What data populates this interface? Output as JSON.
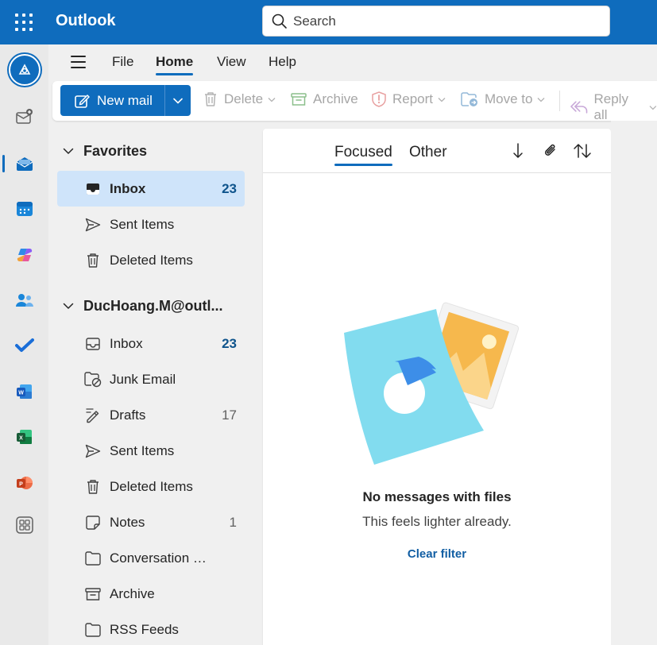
{
  "app": {
    "title": "Outlook"
  },
  "search": {
    "placeholder": "Search"
  },
  "menu": {
    "tabs": [
      "File",
      "Home",
      "View",
      "Help"
    ],
    "active": "Home"
  },
  "ribbon": {
    "new_mail": "New mail",
    "delete": "Delete",
    "archive": "Archive",
    "report": "Report",
    "move_to": "Move to",
    "reply_all": "Reply all"
  },
  "rail": {
    "icons": [
      "avatar",
      "new-mail-icon",
      "mail-icon",
      "calendar-icon",
      "copilot-icon",
      "people-icon",
      "todo-icon",
      "word-icon",
      "excel-icon",
      "powerpoint-icon",
      "more-apps-icon"
    ],
    "active": "mail-icon"
  },
  "favorites": {
    "header": "Favorites",
    "items": [
      {
        "label": "Inbox",
        "count": "23",
        "icon": "inbox-icon",
        "selected": true
      },
      {
        "label": "Sent Items",
        "count": "",
        "icon": "send-icon"
      },
      {
        "label": "Deleted Items",
        "count": "",
        "icon": "trash-icon"
      }
    ]
  },
  "account": {
    "header": "DucHoang.M@outl...",
    "items": [
      {
        "label": "Inbox",
        "count": "23",
        "icon": "inbox-icon"
      },
      {
        "label": "Junk Email",
        "count": "",
        "icon": "junk-icon"
      },
      {
        "label": "Drafts",
        "count": "17",
        "icon": "drafts-icon"
      },
      {
        "label": "Sent Items",
        "count": "",
        "icon": "send-icon"
      },
      {
        "label": "Deleted Items",
        "count": "",
        "icon": "trash-icon"
      },
      {
        "label": "Notes",
        "count": "1",
        "icon": "notes-icon"
      },
      {
        "label": "Conversation Histo...",
        "count": "",
        "icon": "folder-icon"
      },
      {
        "label": "Archive",
        "count": "",
        "icon": "archive-icon"
      },
      {
        "label": "RSS Feeds",
        "count": "",
        "icon": "folder-icon"
      }
    ]
  },
  "message_list": {
    "pivots": [
      "Focused",
      "Other"
    ],
    "active_pivot": "Focused",
    "empty_title": "No messages with files",
    "empty_subtitle": "This feels lighter already.",
    "clear_filter": "Clear filter"
  },
  "colors": {
    "brand": "#0f6cbd",
    "selected": "#cfe4fa",
    "unread": "#0f548c"
  }
}
